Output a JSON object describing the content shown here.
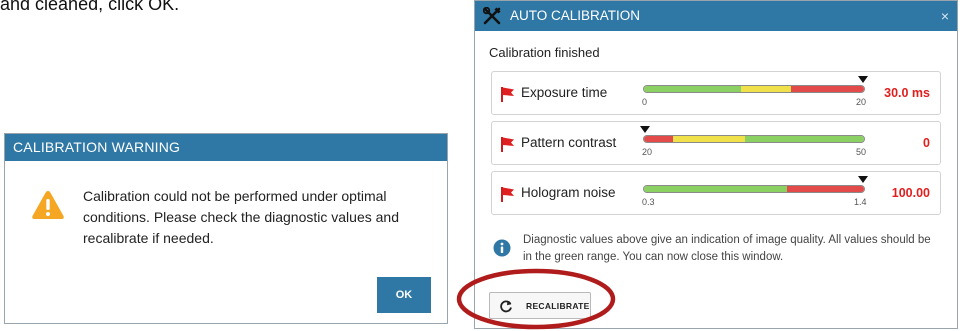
{
  "caption": {
    "text": "and cleaned, click OK."
  },
  "warning_dialog": {
    "title": "CALIBRATION WARNING",
    "message": "Calibration could not be performed under optimal conditions. Please check the diagnostic values and recalibrate if needed.",
    "icon": "warning-triangle-icon",
    "ok_label": "OK"
  },
  "calibration_dialog": {
    "title": "AUTO CALIBRATION",
    "close_label": "×",
    "status": "Calibration finished",
    "metrics": [
      {
        "label": "Exposure time",
        "value": "30.0 ms",
        "min_label": "0",
        "max_label": "20",
        "marker_fraction": 0.99,
        "segments": [
          {
            "fraction": 0.44,
            "color": "#8bd063"
          },
          {
            "fraction": 0.23,
            "color": "#f0e14a"
          },
          {
            "fraction": 0.33,
            "color": "#e34b4b"
          }
        ],
        "status_icon": "red-flag-icon"
      },
      {
        "label": "Pattern contrast",
        "value": "0",
        "min_label": "20",
        "max_label": "50",
        "marker_fraction": 0.01,
        "segments": [
          {
            "fraction": 0.13,
            "color": "#e34b4b"
          },
          {
            "fraction": 0.33,
            "color": "#f0e14a"
          },
          {
            "fraction": 0.54,
            "color": "#8bd063"
          }
        ],
        "status_icon": "red-flag-icon"
      },
      {
        "label": "Hologram noise",
        "value": "100.00",
        "min_label": "0.3",
        "max_label": "1.4",
        "marker_fraction": 0.99,
        "segments": [
          {
            "fraction": 0.65,
            "color": "#8bd063"
          },
          {
            "fraction": 0.35,
            "color": "#e34b4b"
          }
        ],
        "status_icon": "red-flag-icon"
      }
    ],
    "info_text": "Diagnostic values above give an indication of image quality. All values should be in the green range. You can now close this window.",
    "recalibrate_label": "RECALIBRATE"
  },
  "colors": {
    "titlebar": "#2f78a6",
    "value_red": "#e01e1e",
    "highlight": "#b01c1c"
  }
}
